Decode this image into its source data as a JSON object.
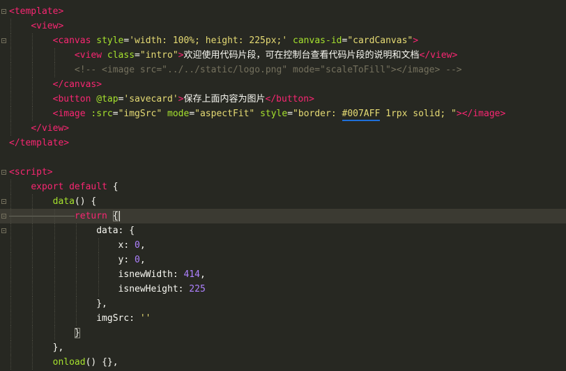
{
  "editor": {
    "lines": [
      {
        "fold": "open",
        "tokens": [
          [
            "tag",
            "<template>"
          ]
        ]
      },
      {
        "fold": "none",
        "tokens": [
          [
            "plain",
            "    "
          ],
          [
            "tag",
            "<view>"
          ]
        ]
      },
      {
        "fold": "open",
        "tokens": [
          [
            "plain",
            "        "
          ],
          [
            "tag",
            "<canvas "
          ],
          [
            "attr",
            "style"
          ],
          [
            "plain",
            "="
          ],
          [
            "str",
            "'width: 100%; height: 225px;'"
          ],
          [
            "plain",
            " "
          ],
          [
            "attr",
            "canvas-id"
          ],
          [
            "plain",
            "="
          ],
          [
            "str",
            "\"cardCanvas\""
          ],
          [
            "tag",
            ">"
          ]
        ]
      },
      {
        "fold": "none",
        "tokens": [
          [
            "plain",
            "            "
          ],
          [
            "tag",
            "<view "
          ],
          [
            "attr",
            "class"
          ],
          [
            "plain",
            "="
          ],
          [
            "str",
            "\"intro\""
          ],
          [
            "tag",
            ">"
          ],
          [
            "plain",
            "欢迎使用代码片段，可在控制台查看代码片段的说明和文档"
          ],
          [
            "tag",
            "</view>"
          ]
        ]
      },
      {
        "fold": "none",
        "tokens": [
          [
            "plain",
            "            "
          ],
          [
            "cmt",
            "<!-- <image src=\"../../static/logo.png\" mode=\"scaleToFill\"></image> -->"
          ]
        ]
      },
      {
        "fold": "none",
        "tokens": [
          [
            "plain",
            "        "
          ],
          [
            "tag",
            "</canvas>"
          ]
        ]
      },
      {
        "fold": "none",
        "tokens": [
          [
            "plain",
            "        "
          ],
          [
            "tag",
            "<button "
          ],
          [
            "attr",
            "@tap"
          ],
          [
            "plain",
            "="
          ],
          [
            "str",
            "'savecard'"
          ],
          [
            "tag",
            ">"
          ],
          [
            "plain",
            "保存上面内容为图片"
          ],
          [
            "tag",
            "</button>"
          ]
        ]
      },
      {
        "fold": "none",
        "tokens": [
          [
            "plain",
            "        "
          ],
          [
            "tag",
            "<image "
          ],
          [
            "attr",
            ":src"
          ],
          [
            "plain",
            "="
          ],
          [
            "str",
            "\"imgSrc\""
          ],
          [
            "plain",
            " "
          ],
          [
            "attr",
            "mode"
          ],
          [
            "plain",
            "="
          ],
          [
            "str",
            "\"aspectFit\""
          ],
          [
            "plain",
            " "
          ],
          [
            "attr",
            "style"
          ],
          [
            "plain",
            "="
          ],
          [
            "str",
            "\"border: "
          ],
          [
            "hex",
            "#007AFF"
          ],
          [
            "str",
            " 1rpx solid; \""
          ],
          [
            "tag",
            "></image>"
          ]
        ]
      },
      {
        "fold": "none",
        "tokens": [
          [
            "plain",
            "    "
          ],
          [
            "tag",
            "</view>"
          ]
        ]
      },
      {
        "fold": "none",
        "tokens": [
          [
            "tag",
            "</template>"
          ]
        ]
      },
      {
        "fold": "none",
        "tokens": []
      },
      {
        "fold": "open",
        "tokens": [
          [
            "tag",
            "<script>"
          ]
        ]
      },
      {
        "fold": "none",
        "tokens": [
          [
            "plain",
            "    "
          ],
          [
            "kw",
            "export"
          ],
          [
            "plain",
            " "
          ],
          [
            "kw",
            "default"
          ],
          [
            "plain",
            " {"
          ]
        ]
      },
      {
        "fold": "open",
        "tokens": [
          [
            "plain",
            "        "
          ],
          [
            "fn",
            "data"
          ],
          [
            "plain",
            "() {"
          ]
        ]
      },
      {
        "fold": "open",
        "current": true,
        "tokens": [
          [
            "plain",
            "            "
          ],
          [
            "kw",
            "return"
          ],
          [
            "plain",
            " "
          ],
          [
            "match",
            "{"
          ]
        ]
      },
      {
        "fold": "open",
        "tokens": [
          [
            "plain",
            "                "
          ],
          [
            "plain",
            "data: {"
          ]
        ]
      },
      {
        "fold": "none",
        "tokens": [
          [
            "plain",
            "                    "
          ],
          [
            "plain",
            "x: "
          ],
          [
            "num",
            "0"
          ],
          [
            "plain",
            ","
          ]
        ]
      },
      {
        "fold": "none",
        "tokens": [
          [
            "plain",
            "                    "
          ],
          [
            "plain",
            "y: "
          ],
          [
            "num",
            "0"
          ],
          [
            "plain",
            ","
          ]
        ]
      },
      {
        "fold": "none",
        "tokens": [
          [
            "plain",
            "                    "
          ],
          [
            "plain",
            "isnewWidth: "
          ],
          [
            "num",
            "414"
          ],
          [
            "plain",
            ","
          ]
        ]
      },
      {
        "fold": "none",
        "tokens": [
          [
            "plain",
            "                    "
          ],
          [
            "plain",
            "isnewHeight: "
          ],
          [
            "num",
            "225"
          ]
        ]
      },
      {
        "fold": "none",
        "tokens": [
          [
            "plain",
            "                "
          ],
          [
            "plain",
            "},"
          ]
        ]
      },
      {
        "fold": "none",
        "tokens": [
          [
            "plain",
            "                "
          ],
          [
            "plain",
            "imgSrc: "
          ],
          [
            "str",
            "''"
          ]
        ]
      },
      {
        "fold": "none",
        "tokens": [
          [
            "plain",
            "            "
          ],
          [
            "match",
            "}"
          ]
        ]
      },
      {
        "fold": "none",
        "tokens": [
          [
            "plain",
            "        "
          ],
          [
            "plain",
            "},"
          ]
        ]
      },
      {
        "fold": "none",
        "tokens": [
          [
            "plain",
            "        "
          ],
          [
            "fn",
            "onload"
          ],
          [
            "plain",
            "() {},"
          ]
        ]
      }
    ]
  }
}
